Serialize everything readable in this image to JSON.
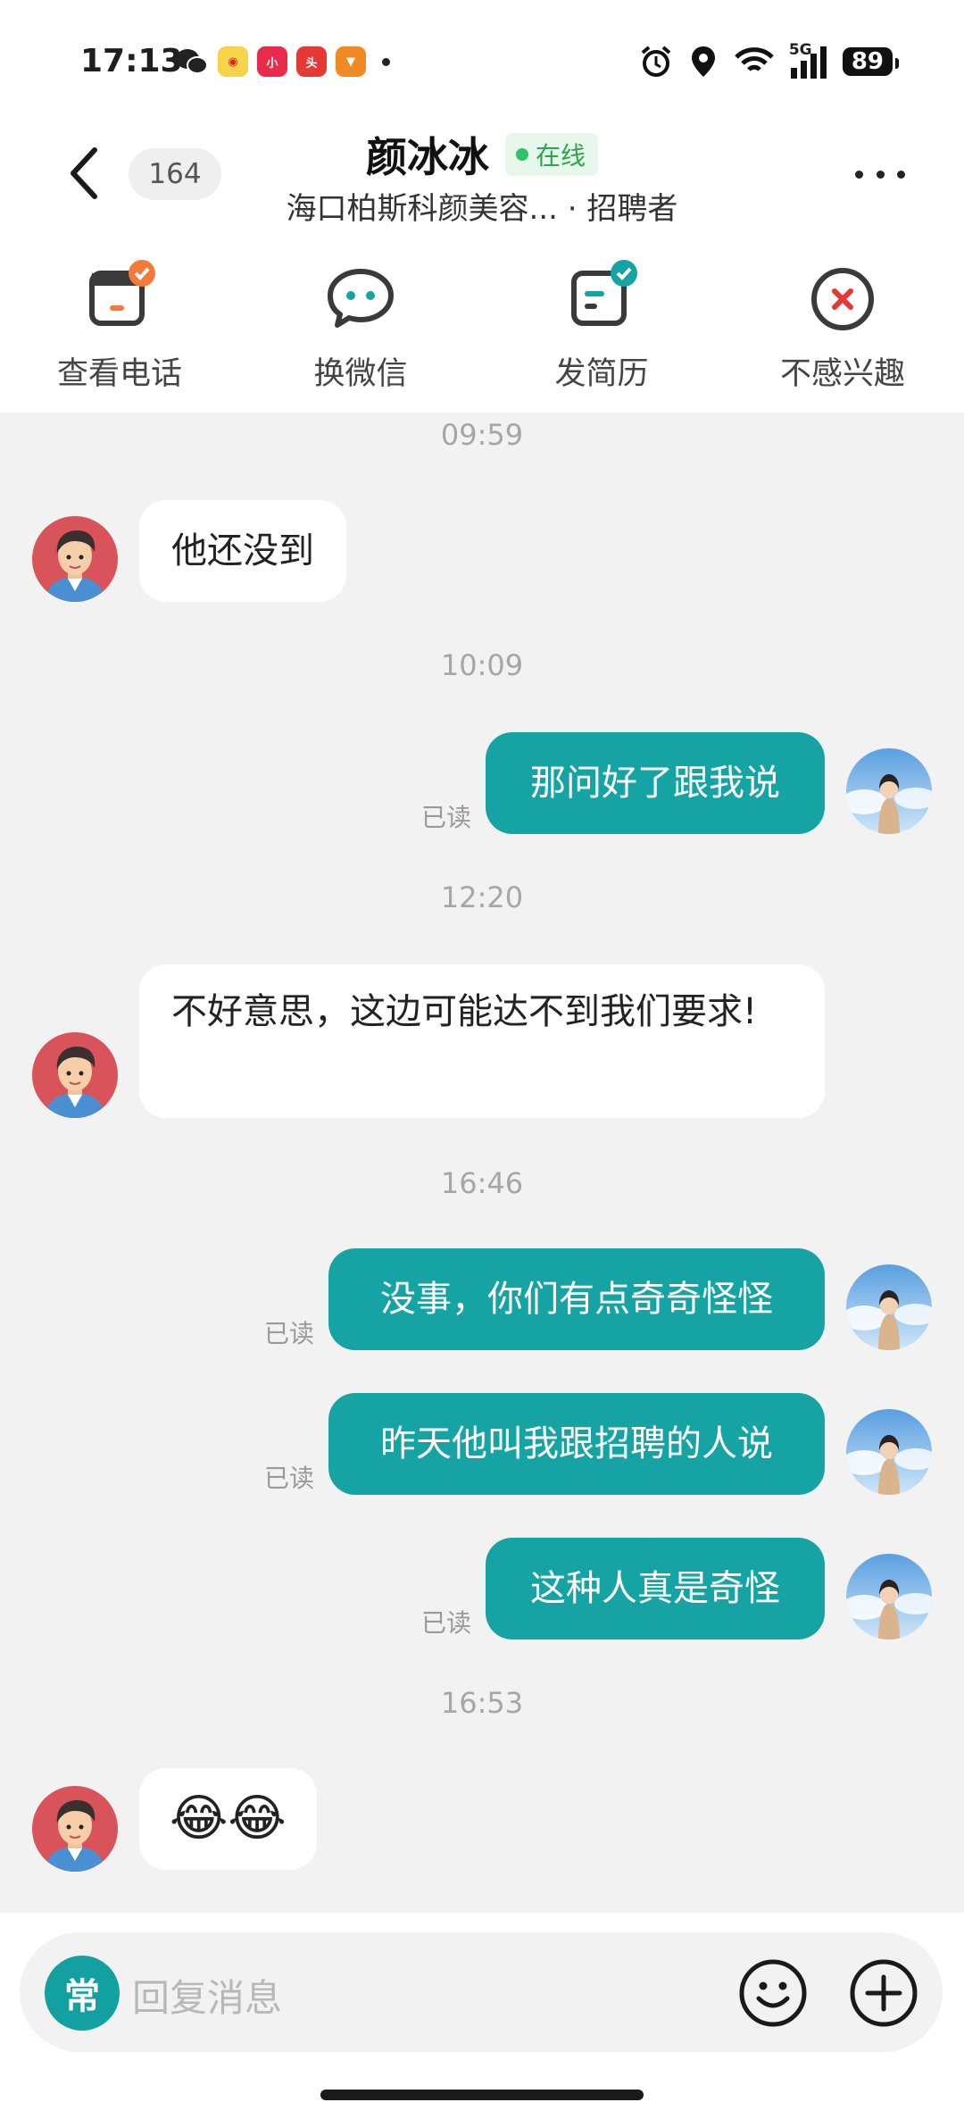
{
  "status_bar": {
    "time": "17:13",
    "battery": "89",
    "network": "5G"
  },
  "header": {
    "unread_count": "164",
    "name": "颜冰冰",
    "online": "在线",
    "subtitle": "海口柏斯科颜美容... · 招聘者"
  },
  "actions": [
    {
      "label": "查看电话",
      "icon": "phone-card-icon"
    },
    {
      "label": "换微信",
      "icon": "wechat-icon"
    },
    {
      "label": "发简历",
      "icon": "resume-icon"
    },
    {
      "label": "不感兴趣",
      "icon": "not-interested-icon"
    }
  ],
  "messages": {
    "ts1": "09:59",
    "m1": "他还没到",
    "ts2": "10:09",
    "m2": "那问好了跟我说",
    "m2_read": "已读",
    "ts3": "12:20",
    "m3": "不好意思，这边可能达不到我们要求!",
    "ts4": "16:46",
    "m4": "没事，你们有点奇奇怪怪",
    "m4_read": "已读",
    "m5": "昨天他叫我跟招聘的人说",
    "m5_read": "已读",
    "m6": "这种人真是奇怪",
    "m6_read": "已读",
    "ts5": "16:53",
    "m7": "😂😂"
  },
  "input": {
    "common_label": "常",
    "placeholder": "回复消息"
  },
  "colors": {
    "accent": "#16a3a3",
    "online": "#2ec26a",
    "badge_orange": "#f47a3c"
  }
}
